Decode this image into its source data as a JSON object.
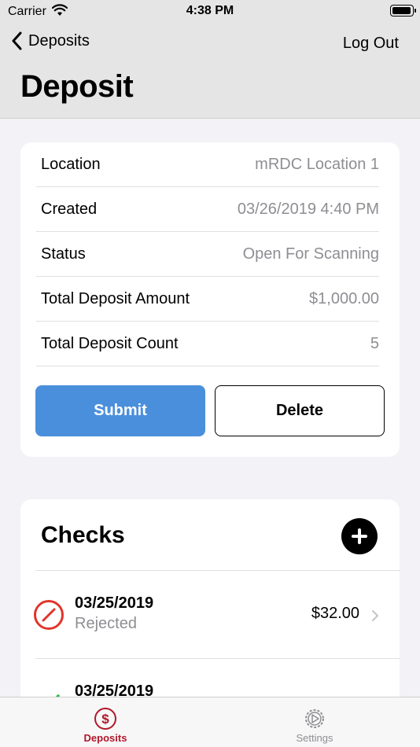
{
  "status_bar": {
    "carrier": "Carrier",
    "time": "4:38 PM"
  },
  "nav": {
    "back_label": "Deposits",
    "logout_label": "Log Out",
    "title": "Deposit"
  },
  "details": [
    {
      "label": "Location",
      "value": "mRDC Location 1"
    },
    {
      "label": "Created",
      "value": "03/26/2019 4:40 PM"
    },
    {
      "label": "Status",
      "value": "Open For Scanning"
    },
    {
      "label": "Total Deposit Amount",
      "value": "$1,000.00"
    },
    {
      "label": "Total Deposit Count",
      "value": "5"
    }
  ],
  "actions": {
    "submit_label": "Submit",
    "delete_label": "Delete"
  },
  "checks": {
    "title": "Checks",
    "items": [
      {
        "date": "03/25/2019",
        "status": "Rejected",
        "amount": "$32.00",
        "icon": "rejected-icon",
        "icon_color": "#e0352b"
      },
      {
        "date": "03/25/2019",
        "status": "",
        "amount": "",
        "icon": "accepted-check-icon",
        "icon_color": "#2eb84a"
      }
    ]
  },
  "tabs": [
    {
      "label": "Deposits",
      "icon": "dollar-circle-icon",
      "active": true
    },
    {
      "label": "Settings",
      "icon": "gear-icon",
      "active": false
    }
  ],
  "colors": {
    "accent": "#b1172c",
    "primary_button": "#4a8fdc",
    "rejected": "#e0352b",
    "accepted": "#2eb84a"
  }
}
